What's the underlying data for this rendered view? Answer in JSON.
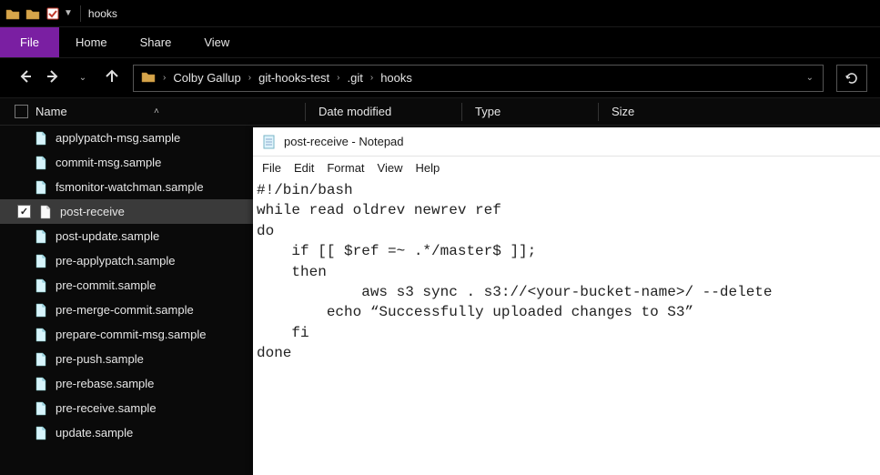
{
  "titlebar": {
    "window_title": "hooks"
  },
  "ribbon": {
    "file_label": "File",
    "tabs": [
      "Home",
      "Share",
      "View"
    ]
  },
  "breadcrumbs": [
    "Colby Gallup",
    "git-hooks-test",
    ".git",
    "hooks"
  ],
  "columns": {
    "name": "Name",
    "date": "Date modified",
    "type": "Type",
    "size": "Size"
  },
  "files": [
    {
      "name": "applypatch-msg.sample",
      "selected": false,
      "icon": "page"
    },
    {
      "name": "commit-msg.sample",
      "selected": false,
      "icon": "page"
    },
    {
      "name": "fsmonitor-watchman.sample",
      "selected": false,
      "icon": "page"
    },
    {
      "name": "post-receive",
      "selected": true,
      "icon": "blank"
    },
    {
      "name": "post-update.sample",
      "selected": false,
      "icon": "page"
    },
    {
      "name": "pre-applypatch.sample",
      "selected": false,
      "icon": "page"
    },
    {
      "name": "pre-commit.sample",
      "selected": false,
      "icon": "page"
    },
    {
      "name": "pre-merge-commit.sample",
      "selected": false,
      "icon": "page"
    },
    {
      "name": "prepare-commit-msg.sample",
      "selected": false,
      "icon": "page"
    },
    {
      "name": "pre-push.sample",
      "selected": false,
      "icon": "page"
    },
    {
      "name": "pre-rebase.sample",
      "selected": false,
      "icon": "page"
    },
    {
      "name": "pre-receive.sample",
      "selected": false,
      "icon": "page"
    },
    {
      "name": "update.sample",
      "selected": false,
      "icon": "page"
    }
  ],
  "notepad": {
    "title": "post-receive - Notepad",
    "menu": [
      "File",
      "Edit",
      "Format",
      "View",
      "Help"
    ],
    "content": "#!/bin/bash\nwhile read oldrev newrev ref\ndo\n    if [[ $ref =~ .*/master$ ]];\n    then\n            aws s3 sync . s3://<your-bucket-name>/ --delete\n        echo “Successfully uploaded changes to S3”\n    fi\ndone"
  }
}
